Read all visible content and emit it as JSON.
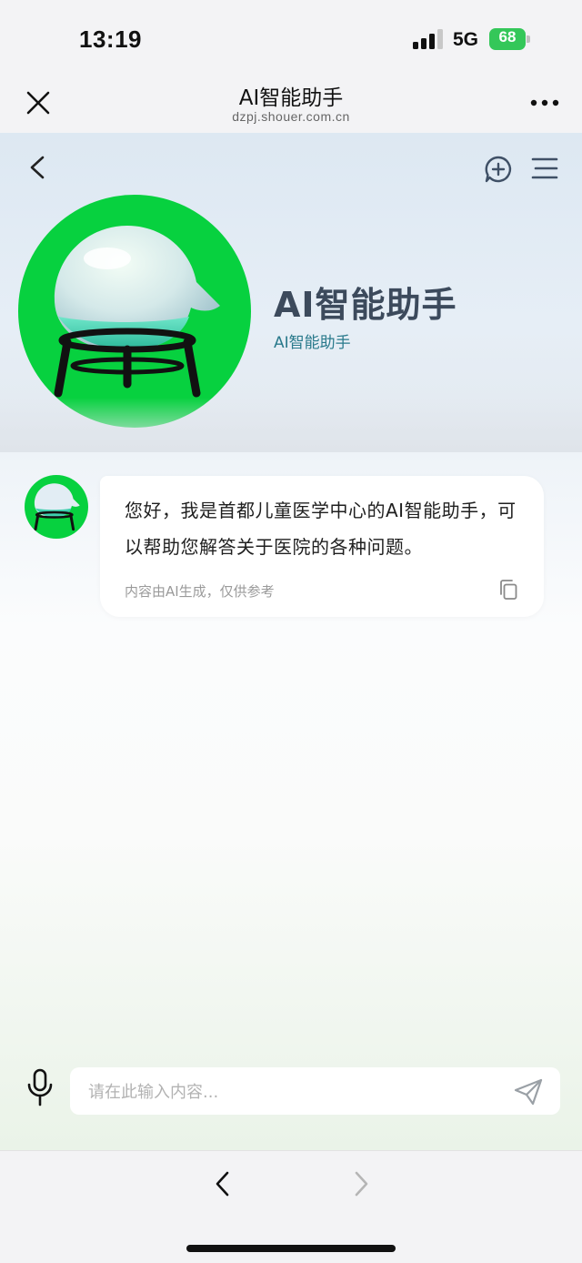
{
  "status_bar": {
    "time": "13:19",
    "network": "5G",
    "battery": "68"
  },
  "browser_nav": {
    "title": "AI智能助手",
    "url": "dzpj.shouer.com.cn",
    "close_icon": "close-icon",
    "more_icon": "more-icon"
  },
  "hero": {
    "name": "AI智能助手",
    "subtitle": "AI智能助手",
    "avatar_bg": "#07d13f"
  },
  "message": {
    "text": "您好，我是首都儿童医学中心的AI智能助手，可以帮助您解答关于医院的各种问题。",
    "note": "内容由AI生成，仅供参考"
  },
  "input": {
    "placeholder": "请在此输入内容..."
  },
  "colors": {
    "accent_green": "#07d13f",
    "title_color": "#3c4a5c",
    "subtitle_color": "#2a7a8c"
  }
}
